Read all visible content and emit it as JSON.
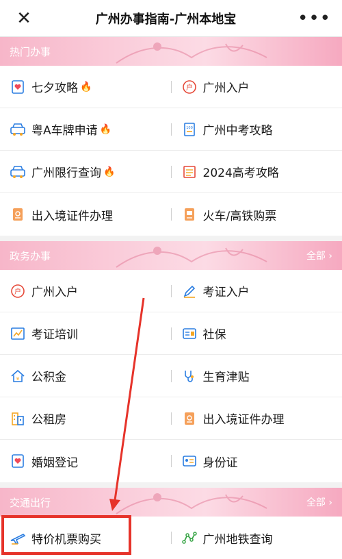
{
  "topbar": {
    "title": "广州办事指南-广州本地宝"
  },
  "sections": [
    {
      "title": "热门办事",
      "show_all": false,
      "all_label": "",
      "rows": [
        [
          {
            "label": "七夕攻略",
            "icon": "heart-doc-icon",
            "hot": true
          },
          {
            "label": "广州入户",
            "icon": "household-icon",
            "hot": false
          }
        ],
        [
          {
            "label": "粤A车牌申请",
            "icon": "car-icon",
            "hot": true
          },
          {
            "label": "广州中考攻略",
            "icon": "exam-doc-icon",
            "hot": false
          }
        ],
        [
          {
            "label": "广州限行查询",
            "icon": "car-icon",
            "hot": true
          },
          {
            "label": "2024高考攻略",
            "icon": "notebook-icon",
            "hot": false
          }
        ],
        [
          {
            "label": "出入境证件办理",
            "icon": "passport-icon",
            "hot": false
          },
          {
            "label": "火车/高铁购票",
            "icon": "ticket-icon",
            "hot": false
          }
        ]
      ]
    },
    {
      "title": "政务办事",
      "show_all": true,
      "all_label": "全部",
      "rows": [
        [
          {
            "label": "广州入户",
            "icon": "household-icon",
            "hot": false
          },
          {
            "label": "考证入户",
            "icon": "pen-icon",
            "hot": false
          }
        ],
        [
          {
            "label": "考证培训",
            "icon": "chart-board-icon",
            "hot": false
          },
          {
            "label": "社保",
            "icon": "social-card-icon",
            "hot": false
          }
        ],
        [
          {
            "label": "公积金",
            "icon": "house-fund-icon",
            "hot": false
          },
          {
            "label": "生育津贴",
            "icon": "stethoscope-icon",
            "hot": false
          }
        ],
        [
          {
            "label": "公租房",
            "icon": "building-icon",
            "hot": false
          },
          {
            "label": "出入境证件办理",
            "icon": "passport-icon",
            "hot": false
          }
        ],
        [
          {
            "label": "婚姻登记",
            "icon": "heart-doc-icon",
            "hot": false
          },
          {
            "label": "身份证",
            "icon": "id-card-icon",
            "hot": false
          }
        ]
      ]
    },
    {
      "title": "交通出行",
      "show_all": true,
      "all_label": "全部",
      "rows": [
        [
          {
            "label": "特价机票购买",
            "icon": "plane-icon",
            "hot": false
          },
          {
            "label": "广州地铁查询",
            "icon": "metro-icon",
            "hot": false
          }
        ]
      ]
    }
  ],
  "colors": {
    "accent": "#f04a1a",
    "header_pink": "#f7b6c9",
    "highlight": "#e6332a",
    "blue": "#2a7de1"
  }
}
